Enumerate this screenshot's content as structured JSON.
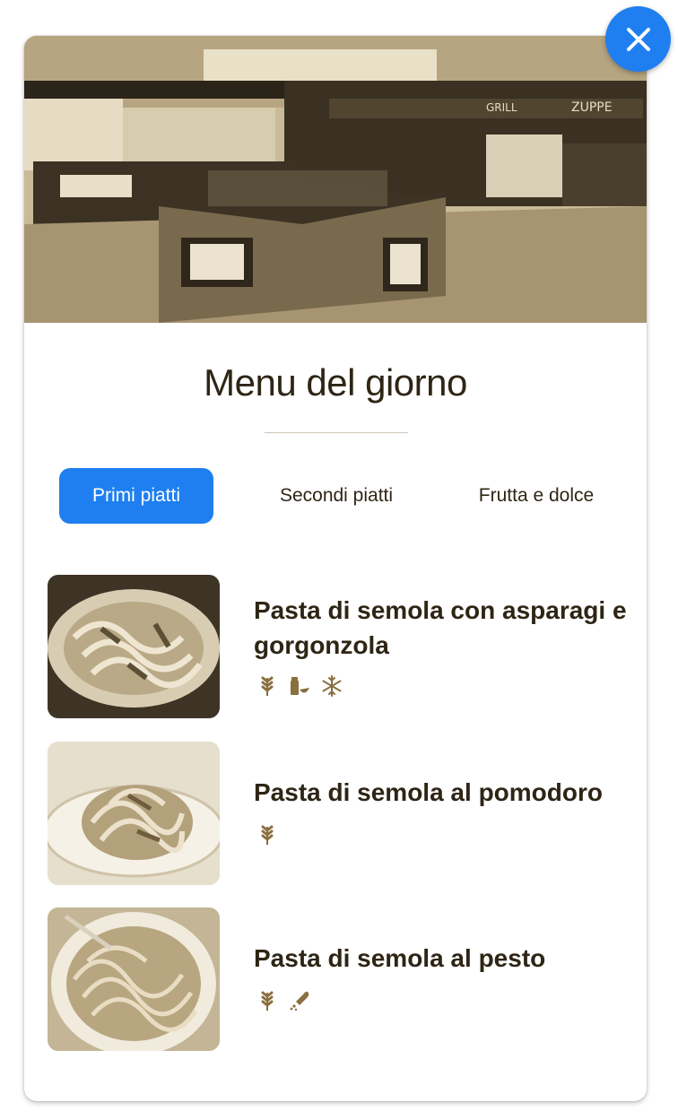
{
  "dialog": {
    "close_icon": "close-icon",
    "hero_image": "cafeteria-interior-photo",
    "title": "Menu del giorno"
  },
  "colors": {
    "accent": "#1f7ff0",
    "text": "#2e2515",
    "icon": "#8a6f3f"
  },
  "tabs": [
    {
      "label": "Primi piatti",
      "active": true
    },
    {
      "label": "Secondi piatti",
      "active": false
    },
    {
      "label": "Frutta e dolce",
      "active": false
    }
  ],
  "dishes": [
    {
      "name": "Pasta di semola con asparagi e gorgonzola",
      "image": "pasta-asparagus-gorgonzola-photo",
      "icons": [
        "wheat-icon",
        "dairy-icon",
        "frozen-icon"
      ]
    },
    {
      "name": "Pasta di semola al pomodoro",
      "image": "pasta-tomato-photo",
      "icons": [
        "wheat-icon"
      ]
    },
    {
      "name": "Pasta di semola al pesto",
      "image": "pasta-pesto-photo",
      "icons": [
        "wheat-icon",
        "nuts-icon"
      ]
    }
  ]
}
